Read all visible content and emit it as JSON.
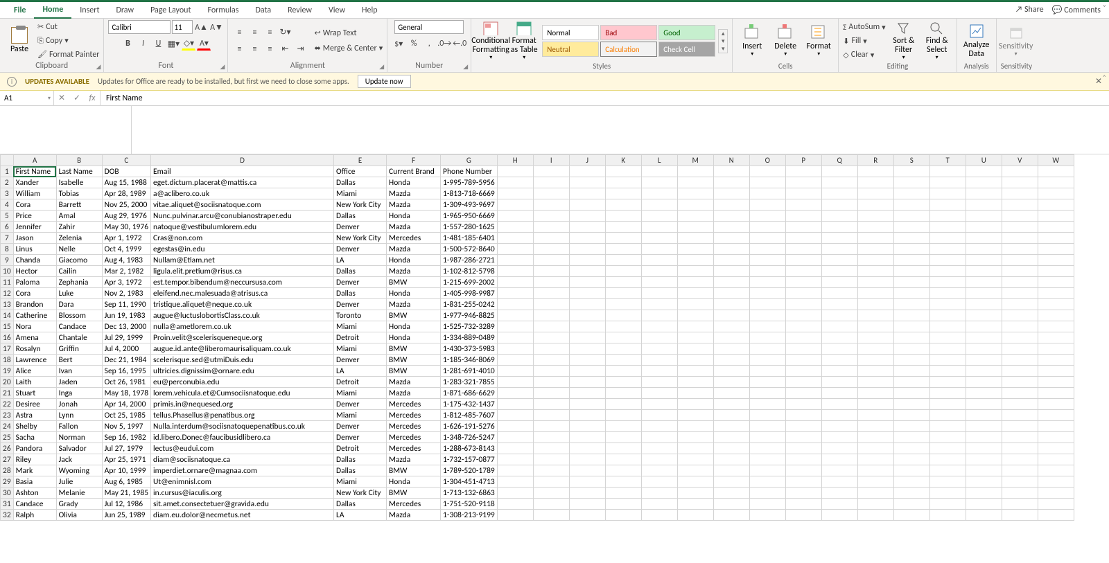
{
  "tabs": {
    "file": "File",
    "home": "Home",
    "insert": "Insert",
    "draw": "Draw",
    "page_layout": "Page Layout",
    "formulas": "Formulas",
    "data": "Data",
    "review": "Review",
    "view": "View",
    "help": "Help"
  },
  "topright": {
    "share": "Share",
    "comments": "Comments"
  },
  "clipboard": {
    "paste": "Paste",
    "cut": "Cut",
    "copy": "Copy",
    "format_painter": "Format Painter",
    "label": "Clipboard"
  },
  "font": {
    "name": "Calibri",
    "size": "11",
    "label": "Font",
    "bold": "B",
    "italic": "I",
    "underline": "U"
  },
  "alignment": {
    "wrap": "Wrap Text",
    "merge": "Merge & Center",
    "label": "Alignment"
  },
  "number": {
    "format": "General",
    "label": "Number"
  },
  "styles": {
    "cond": "Conditional Formatting",
    "fmt_table": "Format as Table",
    "normal": "Normal",
    "bad": "Bad",
    "good": "Good",
    "neutral": "Neutral",
    "calc": "Calculation",
    "check": "Check Cell",
    "label": "Styles"
  },
  "cells": {
    "insert": "Insert",
    "delete": "Delete",
    "format": "Format",
    "label": "Cells"
  },
  "editing": {
    "autosum": "AutoSum",
    "fill": "Fill",
    "clear": "Clear",
    "sort": "Sort & Filter",
    "find": "Find & Select",
    "label": "Editing"
  },
  "analysis": {
    "analyze": "Analyze Data",
    "label": "Analysis"
  },
  "sensitivity": {
    "btn": "Sensitivity",
    "label": "Sensitivity"
  },
  "notification": {
    "title": "UPDATES AVAILABLE",
    "msg": "Updates for Office are ready to be installed, but first we need to close some apps.",
    "button": "Update now"
  },
  "namebox": "A1",
  "formula": "First Name",
  "columns": [
    "A",
    "B",
    "C",
    "D",
    "E",
    "F",
    "G",
    "H",
    "I",
    "J",
    "K",
    "L",
    "M",
    "N",
    "O",
    "P",
    "Q",
    "R",
    "S",
    "T",
    "U",
    "V",
    "W"
  ],
  "headers": [
    "First Name",
    "Last Name",
    "DOB",
    "Email",
    "Office",
    "Current Brand",
    "Phone Number"
  ],
  "rows": [
    [
      "Xander",
      "Isabelle",
      "Aug 15, 1988",
      "eget.dictum.placerat@mattis.ca",
      "Dallas",
      "Honda",
      "1-995-789-5956"
    ],
    [
      "William",
      "Tobias",
      "Apr 28, 1989",
      "a@aclibero.co.uk",
      "Miami",
      "Mazda",
      "1-813-718-6669"
    ],
    [
      "Cora",
      "Barrett",
      "Nov 25, 2000",
      "vitae.aliquet@sociisnatoque.com",
      "New York City",
      "Mazda",
      "1-309-493-9697"
    ],
    [
      "Price",
      "Amal",
      "Aug 29, 1976",
      "Nunc.pulvinar.arcu@conubianostraper.edu",
      "Dallas",
      "Honda",
      "1-965-950-6669"
    ],
    [
      "Jennifer",
      "Zahir",
      "May 30, 1976",
      "natoque@vestibulumlorem.edu",
      "Denver",
      "Mazda",
      "1-557-280-1625"
    ],
    [
      "Jason",
      "Zelenia",
      "Apr 1, 1972",
      "Cras@non.com",
      "New York City",
      "Mercedes",
      "1-481-185-6401"
    ],
    [
      "Linus",
      "Nelle",
      "Oct 4, 1999",
      "egestas@in.edu",
      "Denver",
      "Mazda",
      "1-500-572-8640"
    ],
    [
      "Chanda",
      "Giacomo",
      "Aug 4, 1983",
      "Nullam@Etiam.net",
      "LA",
      "Honda",
      "1-987-286-2721"
    ],
    [
      "Hector",
      "Cailin",
      "Mar 2, 1982",
      "ligula.elit.pretium@risus.ca",
      "Dallas",
      "Mazda",
      "1-102-812-5798"
    ],
    [
      "Paloma",
      "Zephania",
      "Apr 3, 1972",
      "est.tempor.bibendum@neccursusa.com",
      "Denver",
      "BMW",
      "1-215-699-2002"
    ],
    [
      "Cora",
      "Luke",
      "Nov 2, 1983",
      "eleifend.nec.malesuada@atrisus.ca",
      "Dallas",
      "Honda",
      "1-405-998-9987"
    ],
    [
      "Brandon",
      "Dara",
      "Sep 11, 1990",
      "tristique.aliquet@neque.co.uk",
      "Denver",
      "Mazda",
      "1-831-255-0242"
    ],
    [
      "Catherine",
      "Blossom",
      "Jun 19, 1983",
      "augue@luctuslobortisClass.co.uk",
      "Toronto",
      "BMW",
      "1-977-946-8825"
    ],
    [
      "Nora",
      "Candace",
      "Dec 13, 2000",
      "nulla@ametlorem.co.uk",
      "Miami",
      "Honda",
      "1-525-732-3289"
    ],
    [
      "Amena",
      "Chantale",
      "Jul 29, 1999",
      "Proin.velit@scelerisqueneque.org",
      "Detroit",
      "Honda",
      "1-334-889-0489"
    ],
    [
      "Rosalyn",
      "Griffin",
      "Jul 4, 2000",
      "augue.id.ante@liberomaurisaliquam.co.uk",
      "Miami",
      "BMW",
      "1-430-373-5983"
    ],
    [
      "Lawrence",
      "Bert",
      "Dec 21, 1984",
      "scelerisque.sed@utmiDuis.edu",
      "Denver",
      "BMW",
      "1-185-346-8069"
    ],
    [
      "Alice",
      "Ivan",
      "Sep 16, 1995",
      "ultricies.dignissim@ornare.edu",
      "LA",
      "BMW",
      "1-281-691-4010"
    ],
    [
      "Laith",
      "Jaden",
      "Oct 26, 1981",
      "eu@perconubia.edu",
      "Detroit",
      "Mazda",
      "1-283-321-7855"
    ],
    [
      "Stuart",
      "Inga",
      "May 18, 1978",
      "lorem.vehicula.et@Cumsociisnatoque.edu",
      "Miami",
      "Mazda",
      "1-871-686-6629"
    ],
    [
      "Desiree",
      "Jonah",
      "Apr 14, 2000",
      "primis.in@nequesed.org",
      "Denver",
      "Mercedes",
      "1-175-432-1437"
    ],
    [
      "Astra",
      "Lynn",
      "Oct 25, 1985",
      "tellus.Phasellus@penatibus.org",
      "Miami",
      "Mercedes",
      "1-812-485-7607"
    ],
    [
      "Shelby",
      "Fallon",
      "Nov 5, 1997",
      "Nulla.interdum@sociisnatoquepenatibus.co.uk",
      "Denver",
      "Mercedes",
      "1-626-191-5276"
    ],
    [
      "Sacha",
      "Norman",
      "Sep 16, 1982",
      "id.libero.Donec@faucibusidlibero.ca",
      "Denver",
      "Mercedes",
      "1-348-726-5247"
    ],
    [
      "Pandora",
      "Salvador",
      "Jul 27, 1979",
      "lectus@eudui.com",
      "Detroit",
      "Mercedes",
      "1-288-673-8143"
    ],
    [
      "Riley",
      "Jack",
      "Apr 25, 1971",
      "diam@sociisnatoque.ca",
      "Dallas",
      "Mazda",
      "1-732-157-0877"
    ],
    [
      "Mark",
      "Wyoming",
      "Apr 10, 1999",
      "imperdiet.ornare@magnaa.com",
      "Dallas",
      "BMW",
      "1-789-520-1789"
    ],
    [
      "Basia",
      "Julie",
      "Aug 6, 1985",
      "Ut@enimnisl.com",
      "Miami",
      "Honda",
      "1-304-451-4713"
    ],
    [
      "Ashton",
      "Melanie",
      "May 21, 1985",
      "in.cursus@iaculis.org",
      "New York City",
      "BMW",
      "1-713-132-6863"
    ],
    [
      "Candace",
      "Grady",
      "Jul 12, 1986",
      "sit.amet.consectetuer@gravida.edu",
      "Dallas",
      "Mercedes",
      "1-751-520-9118"
    ],
    [
      "Ralph",
      "Olivia",
      "Jun 25, 1989",
      "diam.eu.dolor@necmetus.net",
      "LA",
      "Mazda",
      "1-308-213-9199"
    ]
  ]
}
